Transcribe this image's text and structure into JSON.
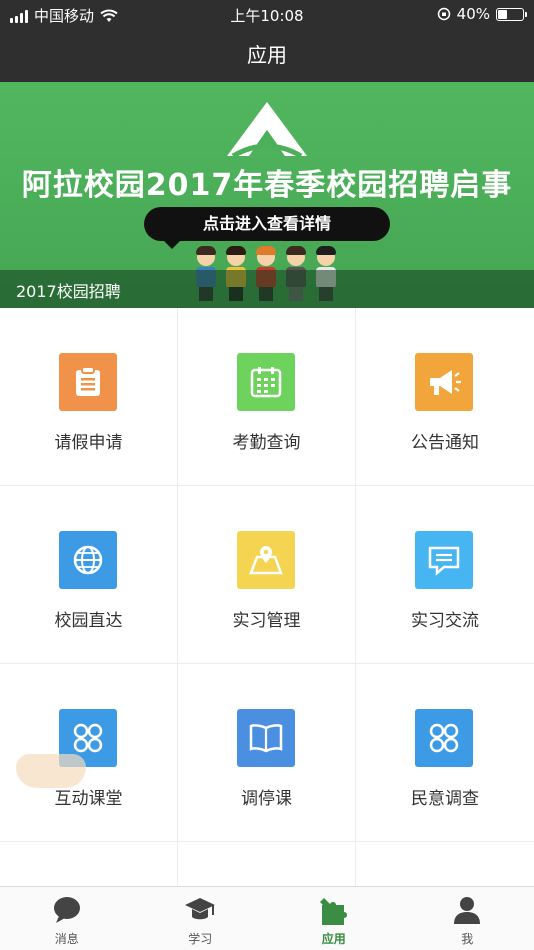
{
  "status_bar": {
    "carrier": "中国移动",
    "time": "上午10:08",
    "battery_text": "40%",
    "battery_level": 0.4
  },
  "nav": {
    "title": "应用"
  },
  "banner": {
    "headline": "阿拉校园2017年春季校园招聘启事",
    "cta": "点击进入查看详情",
    "caption": "2017校园招聘"
  },
  "apps": [
    {
      "label": "请假申请",
      "icon": "clipboard-icon",
      "color": "#f0924a"
    },
    {
      "label": "考勤查询",
      "icon": "calendar-icon",
      "color": "#6dd35c"
    },
    {
      "label": "公告通知",
      "icon": "megaphone-icon",
      "color": "#f2a53a"
    },
    {
      "label": "校园直达",
      "icon": "globe-icon",
      "color": "#3d9be6"
    },
    {
      "label": "实习管理",
      "icon": "map-icon",
      "color": "#f5d451"
    },
    {
      "label": "实习交流",
      "icon": "chat-icon",
      "color": "#47b5f2"
    },
    {
      "label": "互动课堂",
      "icon": "apps-icon",
      "color": "#3d9be6"
    },
    {
      "label": "调停课",
      "icon": "book-icon",
      "color": "#4a8fe0"
    },
    {
      "label": "民意调查",
      "icon": "apps-icon",
      "color": "#3d9be6"
    }
  ],
  "tabs": [
    {
      "label": "消息",
      "icon": "chat-bubble-icon"
    },
    {
      "label": "学习",
      "icon": "graduation-cap-icon"
    },
    {
      "label": "应用",
      "icon": "puzzle-icon"
    },
    {
      "label": "我",
      "icon": "person-icon"
    }
  ],
  "active_tab": "应用",
  "colors": {
    "bar": "#2f2f2f",
    "accent": "#3a8d43",
    "banner": "#4caf5a"
  }
}
